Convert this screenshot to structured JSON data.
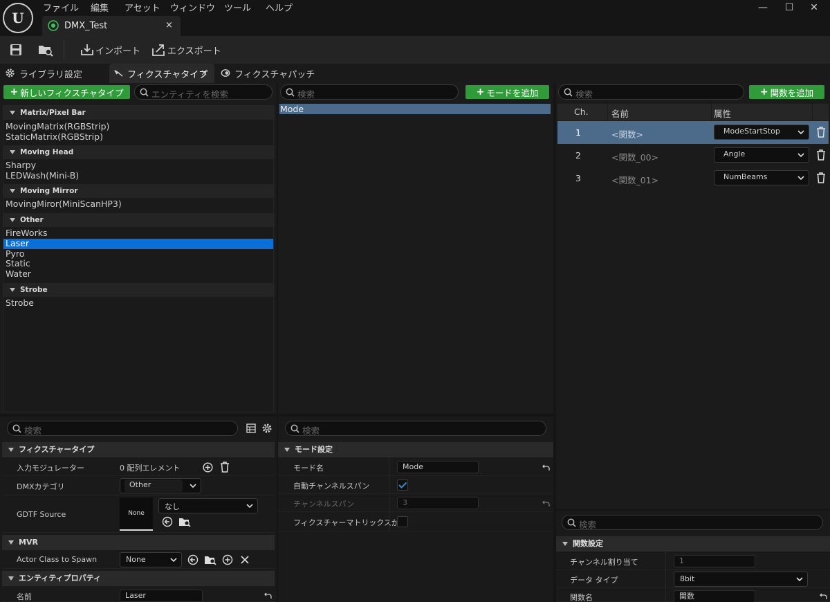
{
  "menu": [
    "ファイル",
    "編集",
    "アセット",
    "ウィンドウ",
    "ツール",
    "ヘルプ"
  ],
  "document_tab": {
    "title": "DMX_Test",
    "close": "×"
  },
  "window_controls": {
    "minimize": "—",
    "maximize": "☐",
    "close": "✕"
  },
  "toolbar": {
    "import_label": "インポート",
    "export_label": "エクスポート"
  },
  "subtabs": {
    "library": "ライブラリ設定",
    "fixture_type": "フィクスチャタイプ",
    "fixture_type_close": "×",
    "fixture_patch": "フィクスチャパッチ"
  },
  "left_panel": {
    "new_button": "新しいフィクスチャタイプ",
    "search_placeholder": "エンティティを検索",
    "categories": [
      {
        "name": "Matrix/Pixel Bar",
        "items": [
          "MovingMatrix(RGBStrip)",
          "StaticMatrix(RGBStrip)"
        ]
      },
      {
        "name": "Moving Head",
        "items": [
          "Sharpy",
          "LEDWash(Mini-B)"
        ]
      },
      {
        "name": "Moving Mirror",
        "items": [
          "MovingMiror(MiniScanHP3)"
        ]
      },
      {
        "name": "Other",
        "items": [
          "FireWorks",
          "Laser",
          "Pyro",
          "Static",
          "Water"
        ]
      },
      {
        "name": "Strobe",
        "items": [
          "Strobe"
        ]
      }
    ],
    "selected_item": "Laser"
  },
  "middle_panel": {
    "search_placeholder": "検索",
    "add_mode_button": "モードを追加",
    "modes": [
      "Mode"
    ]
  },
  "right_panel": {
    "search_placeholder": "検索",
    "add_function_button": "関数を追加",
    "columns": {
      "ch": "Ch.",
      "name": "名前",
      "attribute": "属性"
    },
    "functions": [
      {
        "ch": "1",
        "name": "<関数>",
        "attribute": "ModeStartStop"
      },
      {
        "ch": "2",
        "name": "<関数_00>",
        "attribute": "Angle"
      },
      {
        "ch": "3",
        "name": "<関数_01>",
        "attribute": "NumBeams"
      }
    ]
  },
  "details_left": {
    "search_placeholder": "検索",
    "section_fixture_type": "フィクスチャータイプ",
    "input_modulators_label": "入力モジュレーター",
    "input_modulators_value": "0 配列エレメント",
    "dmx_category_label": "DMXカテゴリ",
    "dmx_category_value": "Other",
    "gdtf_label": "GDTF Source",
    "gdtf_thumb": "None",
    "gdtf_value": "なし",
    "section_mvr": "MVR",
    "actor_class_label": "Actor Class to Spawn",
    "actor_class_value": "None",
    "section_entity": "エンティティプロパティ",
    "name_label": "名前",
    "name_value": "Laser"
  },
  "details_middle": {
    "search_placeholder": "検索",
    "section_mode": "モード設定",
    "mode_name_label": "モード名",
    "mode_name_value": "Mode",
    "auto_span_label": "自動チャンネルスパン",
    "auto_span_checked": true,
    "channel_span_label": "チャンネルスパン",
    "channel_span_value": "3",
    "matrix_label": "フィクスチャーマトリックスが..."
  },
  "details_right": {
    "search_placeholder": "検索",
    "section_function": "関数設定",
    "channel_assign_label": "チャンネル割り当て",
    "channel_assign_value": "1",
    "data_type_label": "データ タイプ",
    "data_type_value": "8bit",
    "function_name_label": "関数名",
    "function_name_value": "関数"
  },
  "colors": {
    "accent_green": "#2f9c39",
    "selection_blue": "#0a6fd6",
    "row_selected": "#4c6a8a"
  }
}
